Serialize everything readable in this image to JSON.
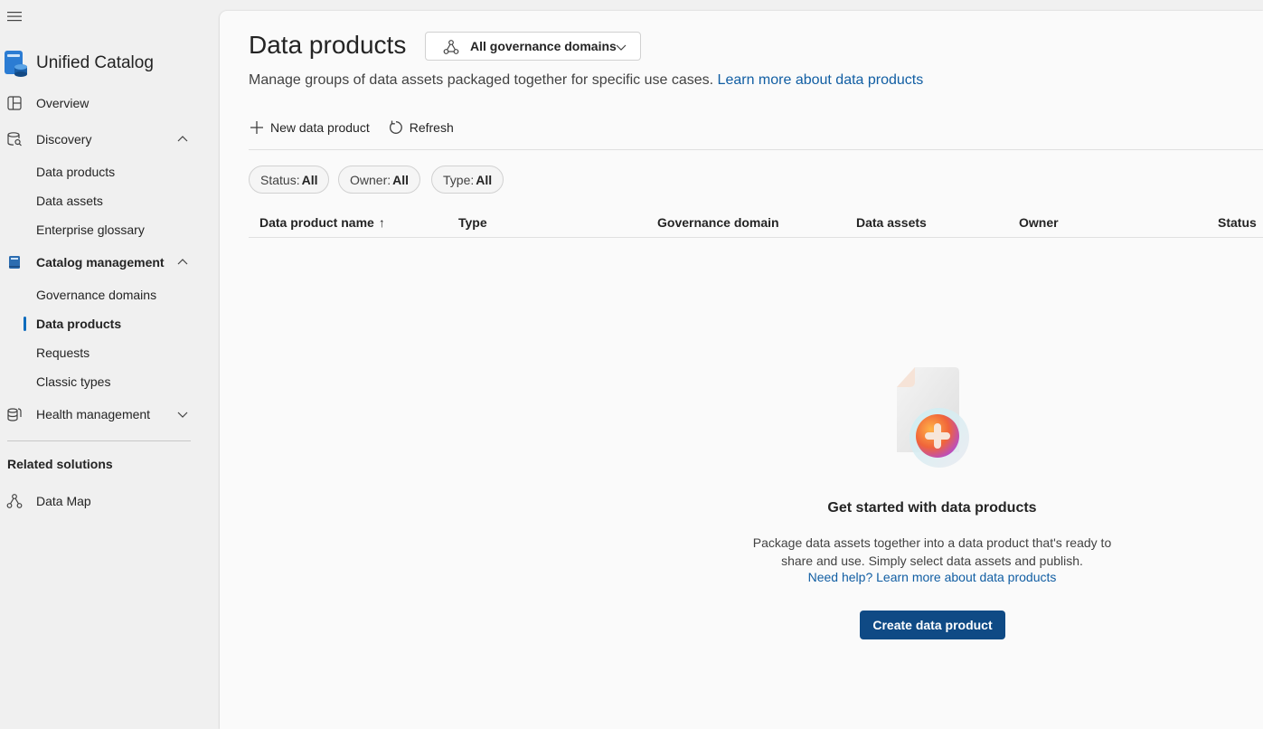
{
  "app": {
    "title": "Unified Catalog"
  },
  "sidebar": {
    "overview": "Overview",
    "discovery": {
      "label": "Discovery",
      "items": [
        "Data products",
        "Data assets",
        "Enterprise glossary"
      ]
    },
    "catalog_management": {
      "label": "Catalog management",
      "items": [
        "Governance domains",
        "Data products",
        "Requests",
        "Classic types"
      ]
    },
    "health_management": "Health management",
    "related_heading": "Related solutions",
    "data_map": "Data Map"
  },
  "page": {
    "title": "Data products",
    "domain_filter": "All governance domains",
    "subtitle": "Manage groups of data assets packaged together for specific use cases.",
    "subtitle_link": "Learn more about data products"
  },
  "toolbar": {
    "new_label": "New data product",
    "refresh_label": "Refresh"
  },
  "filters": [
    {
      "key": "Status:",
      "value": "All"
    },
    {
      "key": "Owner:",
      "value": "All"
    },
    {
      "key": "Type:",
      "value": "All"
    }
  ],
  "table": {
    "columns": [
      "Data product name",
      "Type",
      "Governance domain",
      "Data assets",
      "Owner",
      "Status"
    ],
    "sort_indicator": "↑"
  },
  "empty_state": {
    "title": "Get started with data products",
    "description": "Package data assets together into a data product that's ready to share and use. Simply select data assets and publish.",
    "link": "Need help? Learn more about data products",
    "button": "Create data product"
  }
}
